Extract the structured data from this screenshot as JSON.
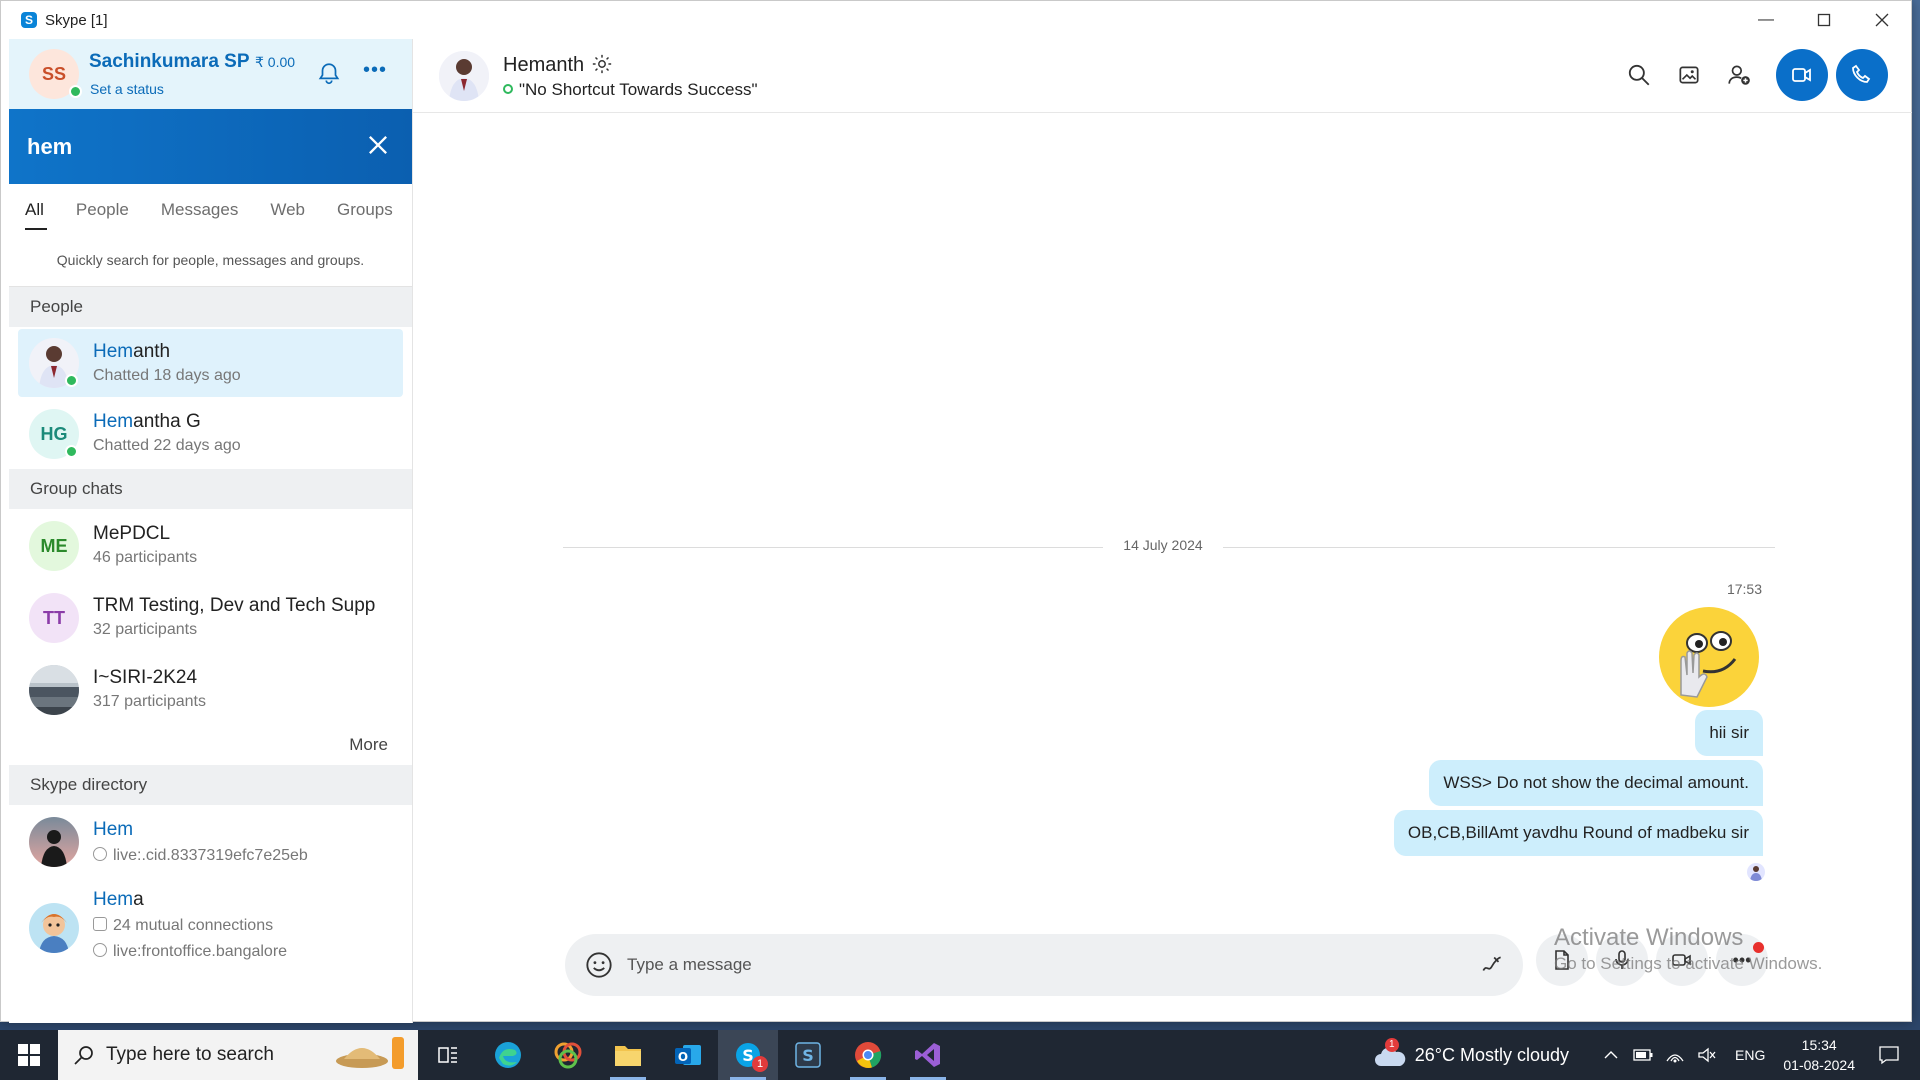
{
  "window": {
    "title": "Skype [1]"
  },
  "profile": {
    "initials": "SS",
    "name": "Sachinkumara SP",
    "credit": "₹ 0.00",
    "status": "Set a status"
  },
  "search": {
    "query": "hem"
  },
  "tabs": [
    "All",
    "People",
    "Messages",
    "Web",
    "Groups"
  ],
  "hint": "Quickly search for people, messages and groups.",
  "sections": {
    "people": "People",
    "groups": "Group chats",
    "directory": "Skype directory",
    "more": "More"
  },
  "people": [
    {
      "match": "Hem",
      "rest": "anth",
      "sub": "Chatted 18 days ago"
    },
    {
      "initials": "HG",
      "match": "Hem",
      "rest": "antha G",
      "sub": "Chatted 22 days ago"
    }
  ],
  "groups": [
    {
      "initials": "ME",
      "name": "MePDCL",
      "sub": "46 participants"
    },
    {
      "initials": "TT",
      "name": "TRM Testing, Dev and Tech Supp",
      "sub": "32 participants"
    },
    {
      "name": "I~SIRI-2K24",
      "sub": "317 participants"
    }
  ],
  "directory": [
    {
      "match": "Hem",
      "rest": "",
      "sub": "live:.cid.8337319efc7e25eb"
    },
    {
      "match": "Hem",
      "rest": "a",
      "mutual": "24 mutual connections",
      "sub": "live:frontoffice.bangalore"
    }
  ],
  "chat": {
    "name": "Hemanth",
    "mood": "\"No Shortcut Towards Success\"",
    "date": "14 July 2024",
    "time": "17:53",
    "messages": [
      "hii sir",
      "WSS> Do not show the decimal amount.",
      "OB,CB,BillAmt yavdhu Round of madbeku sir"
    ],
    "composer_placeholder": "Type a message"
  },
  "watermark": {
    "line1": "Activate Windows",
    "line2": "Go to Settings to activate Windows."
  },
  "taskbar": {
    "search_placeholder": "Type here to search",
    "weather": "26°C  Mostly cloudy",
    "weather_badge": "1",
    "skype_badge": "1",
    "lang": "ENG",
    "time": "15:34",
    "date": "01-08-2024"
  },
  "colors": {
    "accent": "#0b6bb8",
    "search_bar": "#0f74c9",
    "bubble": "#cdeefc",
    "presence": "#2fb95d"
  }
}
